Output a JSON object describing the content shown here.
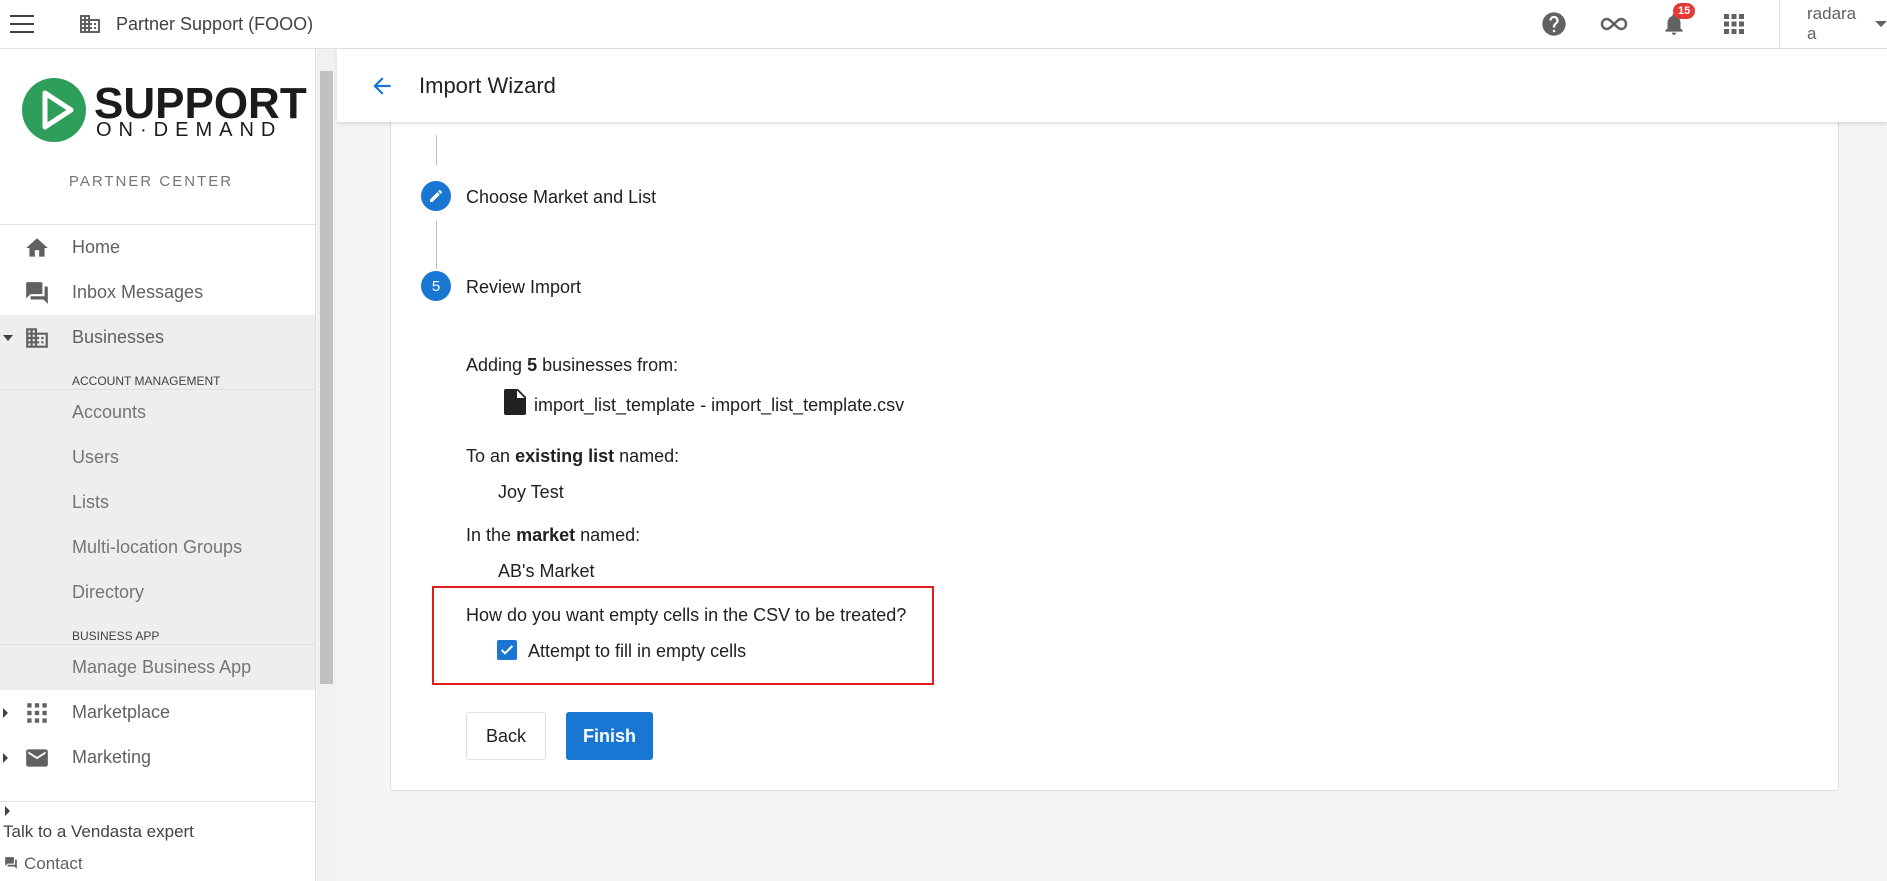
{
  "topbar": {
    "org_name": "Partner Support (FOOO)",
    "notification_count": "15",
    "user_name": "radara a"
  },
  "sidebar": {
    "logo_main": "SUPPORT",
    "logo_sub": "ON·DEMAND",
    "partner_center": "PARTNER CENTER",
    "home": "Home",
    "inbox": "Inbox Messages",
    "businesses": "Businesses",
    "account_management_head": "ACCOUNT MANAGEMENT",
    "account_items": [
      "Accounts",
      "Users",
      "Lists",
      "Multi-location Groups",
      "Directory"
    ],
    "business_app_head": "BUSINESS APP",
    "business_app_items": [
      "Manage Business App"
    ],
    "marketplace": "Marketplace",
    "marketing": "Marketing",
    "footer_expert": "Talk to a Vendasta expert",
    "footer_contact": "Contact"
  },
  "page": {
    "title": "Import Wizard"
  },
  "wizard": {
    "step4_label": "Choose Market and List",
    "step5_number": "5",
    "step5_label": "Review Import",
    "adding_prefix": "Adding",
    "adding_count": "5",
    "adding_suffix": "businesses from:",
    "file_name": "import_list_template - import_list_template.csv",
    "list_prefix": "To an",
    "list_bold": "existing list",
    "list_suffix": "named:",
    "list_name": "Joy Test",
    "market_prefix": "In the",
    "market_bold": "market",
    "market_suffix": "named:",
    "market_name": "AB's Market",
    "empty_cells_question": "How do you want empty cells in the CSV to be treated?",
    "fill_empty_label": "Attempt to fill in empty cells",
    "fill_empty_checked": true,
    "back_label": "Back",
    "finish_label": "Finish"
  },
  "colors": {
    "primary": "#1976d2",
    "highlight": "#e01b1b",
    "badge": "#e53935",
    "logo_green": "#2e9e5b"
  }
}
